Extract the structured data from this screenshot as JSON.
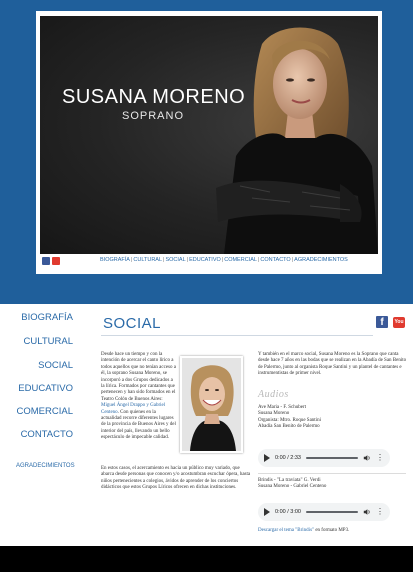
{
  "hero": {
    "name": "SUSANA MORENO",
    "subtitle": "SOPRANO"
  },
  "top_nav": {
    "items": [
      "BIOGRAFÍA",
      "CULTURAL",
      "SOCIAL",
      "EDUCATIVO",
      "COMERCIAL",
      "CONTACTO",
      "AGRADECIMIENTOS"
    ]
  },
  "side_nav": {
    "items": [
      "BIOGRAFÍA",
      "CULTURAL",
      "SOCIAL",
      "EDUCATIVO",
      "COMERCIAL",
      "CONTACTO",
      "AGRADECIMIENTOS"
    ]
  },
  "page": {
    "title": "SOCIAL",
    "intro_a_pre": "Desde hace un tiempo y con la intención de acercar el canto lírico a todos aquellos que no tenían acceso a él, la soprano Susana Moreno, se incorporó a dos Grupos dedicados a la lírica. Formados por cantantes que pertenecen y han sido formados en el Teatro Colón de Buenos Aires: ",
    "intro_a_link": "Miguel Ángel Drappo y Gabriel Centeno",
    "intro_a_post": ". Con quienes en la actualidad recorre diferentes lugares de la provincia de Buenos Aires y del interior del país, llevando un bello espectáculo de impecable calidad.",
    "intro_b": "En estos casos, el acercamiento es hacia un público muy variado, que abarca desde personas que conocen y/o acostumbran escuchar ópera, hasta niños pertenecientes a colegios, ávidos de aprender de los conciertos didácticos que estos Grupos Líricos ofrecen en dichas instituciones.",
    "col2_text": "Y también en el marco social, Susana Moreno es la Soprano que canta desde hace 7 años en las bodas que se realizan en la Abadía de San Benito de Palermo, junto al organista Roque Santini y un plantel de cantantes e instrumentistas de primer nivel."
  },
  "audios": {
    "heading": "Audios",
    "track1": {
      "lines": [
        "Ave Maria - F. Schubert",
        "Susana Moreno",
        "Organista: Mtro. Roque Santini",
        "Abadía San Benito de Palermo"
      ],
      "time": "0:00 / 2:33"
    },
    "track2": {
      "lines": [
        "Brindis - \"La traviata\" G. Verdi",
        "Susana Moreno - Gabriel Centeno"
      ],
      "time": "0:00 / 3:00"
    },
    "download_link": "Descargar el tema \"Brindis\"",
    "download_suffix": " en formato MP3."
  },
  "icons": {
    "facebook": "facebook-icon",
    "youtube": "youtube-icon",
    "youtube_label": "You"
  },
  "colors": {
    "brand_blue": "#1f5f9b",
    "link_blue": "#2a6aa8",
    "facebook": "#3b5998",
    "youtube": "#e03a2f"
  }
}
